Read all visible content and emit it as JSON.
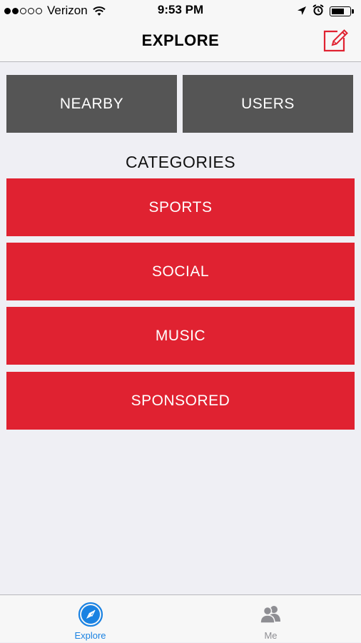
{
  "status_bar": {
    "carrier": "Verizon",
    "time": "9:53 PM",
    "signal_bars_filled": 2,
    "signal_bars_total": 5,
    "battery_level": 0.7,
    "icons": [
      "signal-icon",
      "wifi-icon",
      "location-arrow-icon",
      "alarm-icon",
      "battery-icon"
    ]
  },
  "nav": {
    "title": "EXPLORE",
    "compose_icon": "compose-icon"
  },
  "top_buttons": [
    {
      "label": "NEARBY"
    },
    {
      "label": "USERS"
    }
  ],
  "categories": {
    "heading": "CATEGORIES",
    "items": [
      {
        "label": "SPORTS"
      },
      {
        "label": "SOCIAL"
      },
      {
        "label": "MUSIC"
      },
      {
        "label": "SPONSORED"
      }
    ]
  },
  "tab_bar": {
    "tabs": [
      {
        "label": "Explore",
        "icon": "compass-icon",
        "active": true
      },
      {
        "label": "Me",
        "icon": "users-icon",
        "active": false
      }
    ]
  },
  "colors": {
    "accent_red": "#e02231",
    "button_gray": "#555555",
    "active_tab_blue": "#1a82e2",
    "background": "#efeff4"
  }
}
